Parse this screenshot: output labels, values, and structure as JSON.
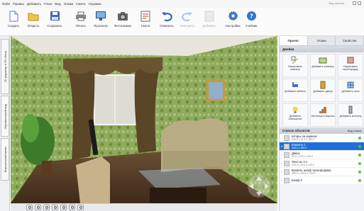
{
  "menu": [
    "Файл",
    "Правка",
    "Добавить",
    "План",
    "Вид",
    "Этажи",
    "Смета",
    "Справка"
  ],
  "search_hint": "Вид панели",
  "toolbar": [
    {
      "label": "Создать",
      "icon": "new-file-icon",
      "disabled": false
    },
    {
      "label": "Открыть",
      "icon": "open-folder-icon",
      "disabled": false
    },
    {
      "label": "Сохранить",
      "icon": "save-icon",
      "disabled": false
    },
    {
      "label": "Печать",
      "icon": "printer-icon",
      "disabled": false
    },
    {
      "label": "Просмотр",
      "icon": "monitor-icon",
      "disabled": false
    },
    {
      "label": "Фотоснимок",
      "icon": "camera-icon",
      "disabled": false
    },
    {
      "label": "Смета",
      "icon": "estimate-icon",
      "disabled": false
    },
    {
      "label": "Отменить",
      "icon": "undo-icon",
      "disabled": false
    },
    {
      "label": "Повторить",
      "icon": "redo-icon",
      "disabled": true
    },
    {
      "label": "Добавить",
      "icon": "add-object-icon",
      "disabled": true
    },
    {
      "label": "Настройки",
      "icon": "gear-icon",
      "disabled": false
    },
    {
      "label": "Учебник",
      "icon": "help-icon",
      "disabled": false
    }
  ],
  "left_tabs": [
    "2D редактор и 3D обзор",
    "Вертикальный вид",
    "Виртуальный визит"
  ],
  "right_panel": {
    "tabs": [
      {
        "label": "Проект",
        "active": true
      },
      {
        "label": "Этажи",
        "active": false
      },
      {
        "label": "Свойства",
        "active": false
      }
    ],
    "add_section": "Двойки",
    "add_items": [
      {
        "label": "Нарисовать комнату",
        "icon": "draw-room-icon"
      },
      {
        "label": "Добавить комнату",
        "icon": "add-room-icon"
      },
      {
        "label": "Нарисовать перегородку",
        "icon": "draw-partition-icon"
      },
      {
        "label": "Добавить мебель",
        "icon": "add-furniture-icon"
      },
      {
        "label": "Добавить дверь",
        "icon": "add-door-icon"
      },
      {
        "label": "Добавить окно",
        "icon": "add-window-icon"
      },
      {
        "label": "Добавить освещение",
        "icon": "add-light-icon"
      },
      {
        "label": "Лестница в вырезы",
        "icon": "stairs-icon"
      },
      {
        "label": "Добавить колонну",
        "icon": "add-column-icon"
      }
    ],
    "objects_title": "Список объектов",
    "objects_view_tab": "Вид этажа",
    "objects": [
      {
        "name": "Шторы на карнизе",
        "dims": "295.0 x 30.3 x 233.9",
        "selected": false
      },
      {
        "name": "Комната 1",
        "dims": "330.0 x 260.0",
        "selected": true
      },
      {
        "name": "Дверь",
        "dims": "90.0 x 10.0 x 200.0",
        "selected": false
      },
      {
        "name": "Окно из 4-х",
        "dims": "230.0 x 15.0 x 140.0",
        "selected": false
      },
      {
        "name": "Кровать шкаф трансформер",
        "dims": "280.0 x 240.0 x 230.0",
        "selected": false
      },
      {
        "name": "Шкаф 2",
        "dims": "",
        "selected": false
      }
    ]
  }
}
